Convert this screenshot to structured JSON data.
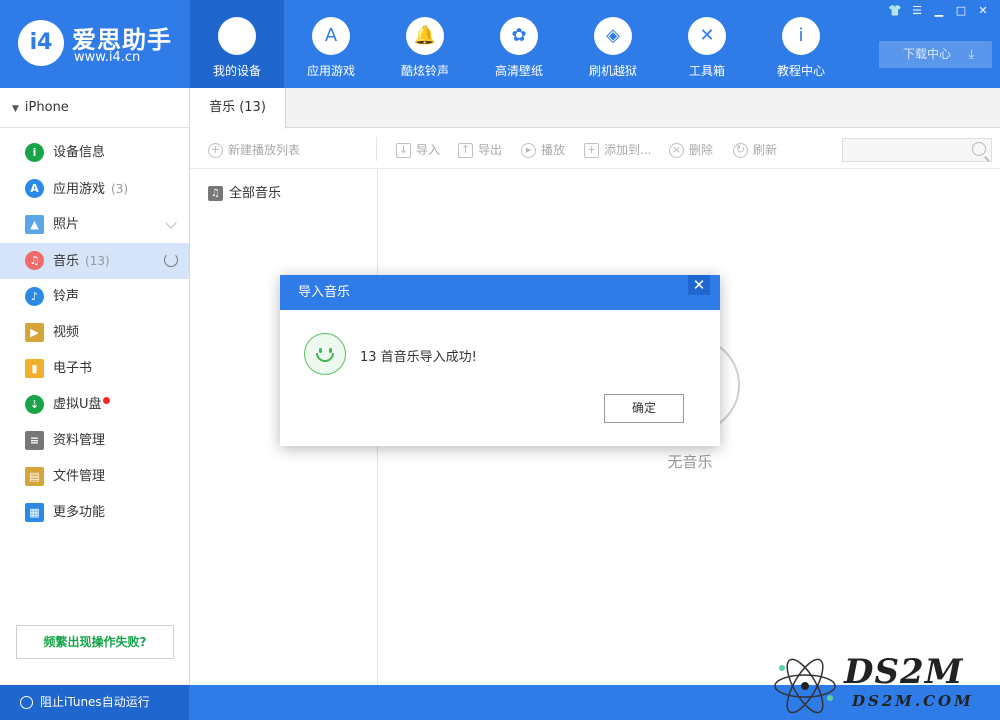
{
  "app": {
    "logo_badge": "i4",
    "name": "爱思助手",
    "url": "www.i4.cn"
  },
  "nav": [
    {
      "label": "我的设备",
      "icon": "apple-icon",
      "glyph": "",
      "active": true
    },
    {
      "label": "应用游戏",
      "icon": "app-store-icon",
      "glyph": "A"
    },
    {
      "label": "酷炫铃声",
      "icon": "bell-icon",
      "glyph": "🔔"
    },
    {
      "label": "高清壁纸",
      "icon": "flower-icon",
      "glyph": "✿"
    },
    {
      "label": "刷机越狱",
      "icon": "dropbox-icon",
      "glyph": "◈"
    },
    {
      "label": "工具箱",
      "icon": "tools-icon",
      "glyph": "✕"
    },
    {
      "label": "教程中心",
      "icon": "info-icon",
      "glyph": "i"
    }
  ],
  "download_center": "下载中心",
  "device": "iPhone",
  "sidebar": [
    {
      "label": "设备信息",
      "icon": "info-icon",
      "color": "#1aa34a",
      "glyph": "i"
    },
    {
      "label": "应用游戏",
      "count": "(3)",
      "icon": "app-store-icon",
      "color": "#2a8ae6",
      "glyph": "A"
    },
    {
      "label": "照片",
      "icon": "photo-icon",
      "color": "#5aa6e8",
      "glyph": "▲",
      "chevron": true
    },
    {
      "label": "音乐",
      "count": "(13)",
      "icon": "music-icon",
      "color": "#f06a6a",
      "glyph": "♫",
      "active": true
    },
    {
      "label": "铃声",
      "icon": "bell-icon",
      "color": "#2a8ae6",
      "glyph": "♪"
    },
    {
      "label": "视频",
      "icon": "video-icon",
      "color": "#d6a53a",
      "glyph": "▶"
    },
    {
      "label": "电子书",
      "icon": "book-icon",
      "color": "#f2b02a",
      "glyph": "▮"
    },
    {
      "label": "虚拟U盘",
      "icon": "usb-icon",
      "color": "#1aa34a",
      "glyph": "⇣",
      "dot": true
    },
    {
      "label": "资料管理",
      "icon": "contacts-icon",
      "color": "#777777",
      "glyph": "≡"
    },
    {
      "label": "文件管理",
      "icon": "file-icon",
      "color": "#d6a53a",
      "glyph": "▤"
    },
    {
      "label": "更多功能",
      "icon": "grid-icon",
      "color": "#2a8ae6",
      "glyph": "▦"
    }
  ],
  "help_button": "频繁出现操作失败?",
  "footer_option": "阻止iTunes自动运行",
  "tab": "音乐 (13)",
  "toolbar": {
    "new_playlist": "新建播放列表",
    "import": "导入",
    "export": "导出",
    "play": "播放",
    "add_to": "添加到...",
    "delete": "删除",
    "refresh": "刷新"
  },
  "playlist": "全部音乐",
  "empty_text": "无音乐",
  "dialog": {
    "title": "导入音乐",
    "message": "13 首音乐导入成功!",
    "ok": "确定"
  },
  "watermark": {
    "big": "DS2M",
    "small": "DS2M.COM"
  }
}
